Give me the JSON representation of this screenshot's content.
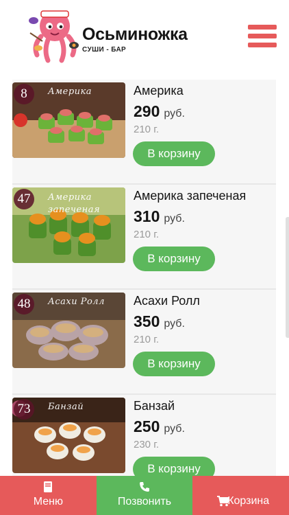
{
  "brand": {
    "name": "Осьминожка",
    "tagline": "СУШИ - БАР"
  },
  "products": [
    {
      "number": "8",
      "image_label": "Америка",
      "name": "Америка",
      "price": "290",
      "currency": "руб.",
      "weight": "210 г.",
      "button": "В корзину"
    },
    {
      "number": "47",
      "image_label": "Америка запеченая",
      "name": "Америка запеченая",
      "price": "310",
      "currency": "руб.",
      "weight": "210 г.",
      "button": "В корзину"
    },
    {
      "number": "48",
      "image_label": "Асахи Ролл",
      "name": "Асахи Ролл",
      "price": "350",
      "currency": "руб.",
      "weight": "210 г.",
      "button": "В корзину"
    },
    {
      "number": "73",
      "image_label": "Банзай",
      "name": "Банзай",
      "price": "250",
      "currency": "руб.",
      "weight": "230 г.",
      "button": "В корзину"
    }
  ],
  "bottom_nav": {
    "menu": "Меню",
    "call": "Позвонить",
    "cart": "Корзина"
  },
  "colors": {
    "accent_red": "#e65a5a",
    "accent_green": "#5cb85c"
  },
  "icons": {
    "menu": "book-icon",
    "call": "phone-icon",
    "cart": "cart-icon",
    "header": "hamburger-icon"
  }
}
